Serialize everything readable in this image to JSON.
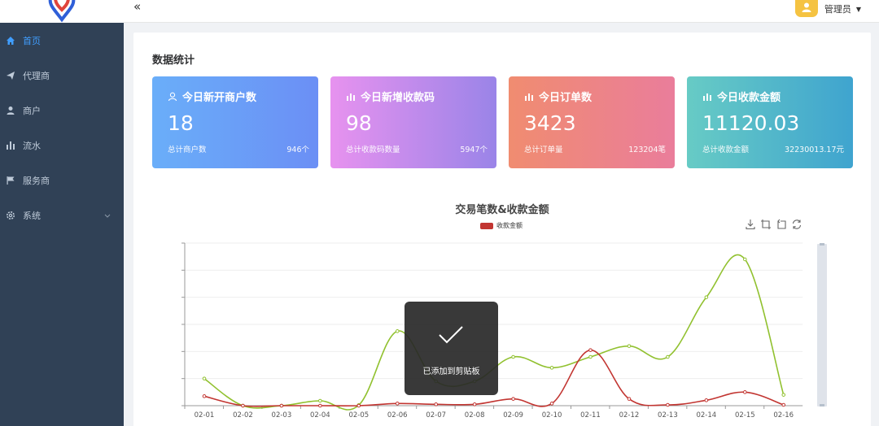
{
  "sidebar": {
    "items": [
      {
        "label": "首页",
        "icon": "home-icon"
      },
      {
        "label": "代理商",
        "icon": "send-icon"
      },
      {
        "label": "商户",
        "icon": "user-icon"
      },
      {
        "label": "流水",
        "icon": "bar-chart-icon"
      },
      {
        "label": "服务商",
        "icon": "flag-icon"
      },
      {
        "label": "系统",
        "icon": "gear-icon"
      }
    ]
  },
  "header": {
    "user_name": "管理员"
  },
  "page": {
    "section_title": "数据统计"
  },
  "stats": [
    {
      "title": "今日新开商户数",
      "value": "18",
      "sub_label": "总计商户数",
      "total": "946个",
      "icon": "user-outline-icon"
    },
    {
      "title": "今日新增收款码",
      "value": "98",
      "sub_label": "总计收款码数量",
      "total": "5947个",
      "icon": "bar-chart-icon"
    },
    {
      "title": "今日订单数",
      "value": "3423",
      "sub_label": "总计订单量",
      "total": "123204笔",
      "icon": "bar-chart-icon"
    },
    {
      "title": "今日收款金额",
      "value": "11120.03",
      "sub_label": "总计收款金额",
      "total": "32230013.17元",
      "icon": "bar-chart-icon"
    }
  ],
  "toast": {
    "text": "已添加到剪贴板"
  },
  "colors": {
    "series_red": "#c23531",
    "series_green": "#91c12f",
    "sidebar_bg": "#304156",
    "active": "#409eff"
  },
  "chart_data": {
    "type": "line",
    "title": "交易笔数&收款金额",
    "legend": [
      "收款金额"
    ],
    "legend_position": "top-center",
    "grid": true,
    "categories": [
      "02-01",
      "02-02",
      "02-03",
      "02-04",
      "02-05",
      "02-06",
      "02-07",
      "02-08",
      "02-09",
      "02-10",
      "02-11",
      "02-12",
      "02-13",
      "02-14",
      "02-15",
      "02-16"
    ],
    "ylim": [
      0,
      6
    ],
    "series": [
      {
        "name": "收款金额",
        "values": [
          0.35,
          0.0,
          0.0,
          0.0,
          0.0,
          0.08,
          0.05,
          0.05,
          0.25,
          0.08,
          2.05,
          0.25,
          0.03,
          0.2,
          0.5,
          0.03
        ]
      },
      {
        "values": [
          1.0,
          0.0,
          0.0,
          0.18,
          0.02,
          2.75,
          0.9,
          0.9,
          1.8,
          1.4,
          1.8,
          2.2,
          1.8,
          4.0,
          5.4,
          0.4
        ]
      }
    ]
  }
}
